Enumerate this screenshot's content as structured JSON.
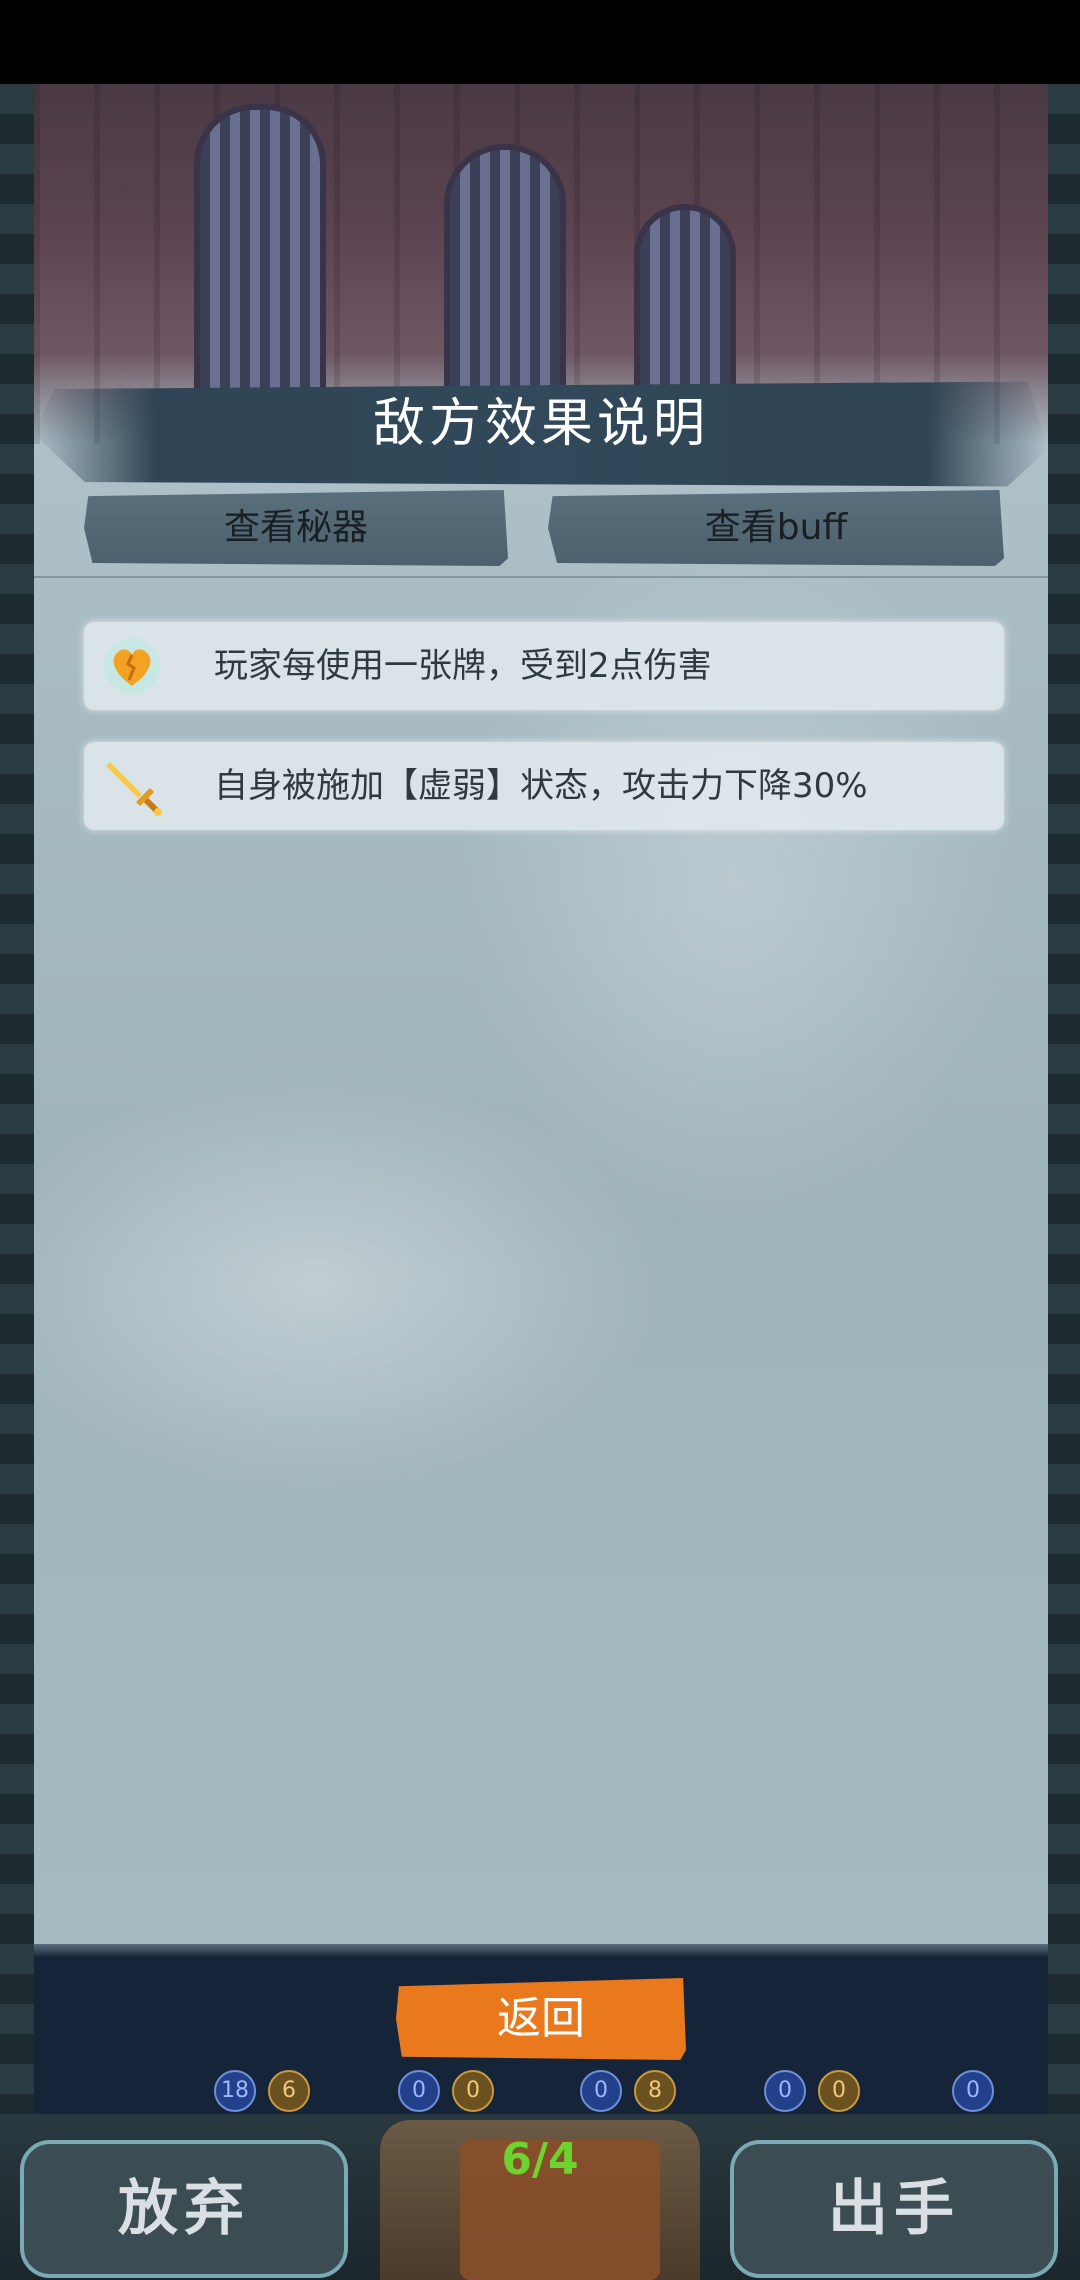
{
  "header": {
    "title": "敌方效果说明"
  },
  "tabs": [
    {
      "label": "查看秘器"
    },
    {
      "label": "查看buff"
    }
  ],
  "effects": [
    {
      "icon": "broken-heart-icon",
      "text": "玩家每使用一张牌，受到2点伤害"
    },
    {
      "icon": "golden-sword-icon",
      "text": "自身被施加【虚弱】状态，攻击力下降30%"
    }
  ],
  "footer": {
    "return_label": "返回"
  },
  "battle": {
    "tokens": [
      "18",
      "6",
      "0",
      "0",
      "0",
      "8",
      "0",
      "0",
      "0"
    ],
    "deck_count": "6/4",
    "abandon_label": "放弃",
    "play_label": "出手"
  },
  "colors": {
    "accent_orange": "#e9791c",
    "title_band": "#31495a",
    "deck_green": "#6ed32e"
  }
}
